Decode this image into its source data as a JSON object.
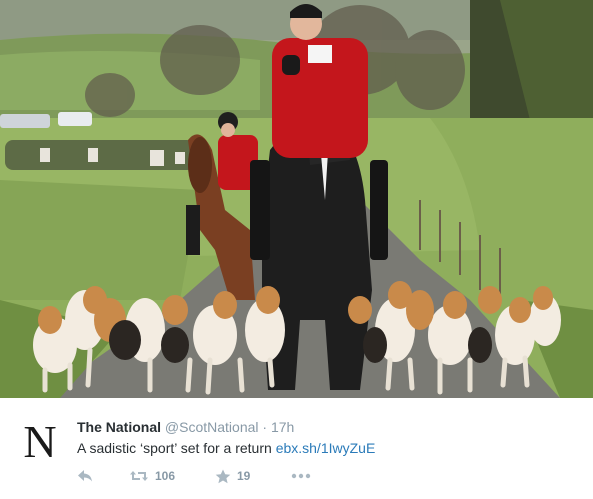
{
  "photo": {
    "alt_icon": "hunt-photo"
  },
  "tweet": {
    "avatar_letter": "N",
    "display_name": "The National",
    "handle": "@ScotNational",
    "separator": "·",
    "time": "17h",
    "text": "A sadistic ‘sport’ set for a return ",
    "link": "ebx.sh/1IwyZuE",
    "actions": {
      "reply_icon": "reply-icon",
      "retweet_icon": "retweet-icon",
      "retweet_count": "106",
      "favorite_icon": "star-icon",
      "favorite_count": "19",
      "more_icon": "more-icon"
    }
  },
  "colors": {
    "link": "#2b7bb9",
    "muted": "#8899a6",
    "text": "#292f33",
    "coat_red": "#c4161c"
  }
}
